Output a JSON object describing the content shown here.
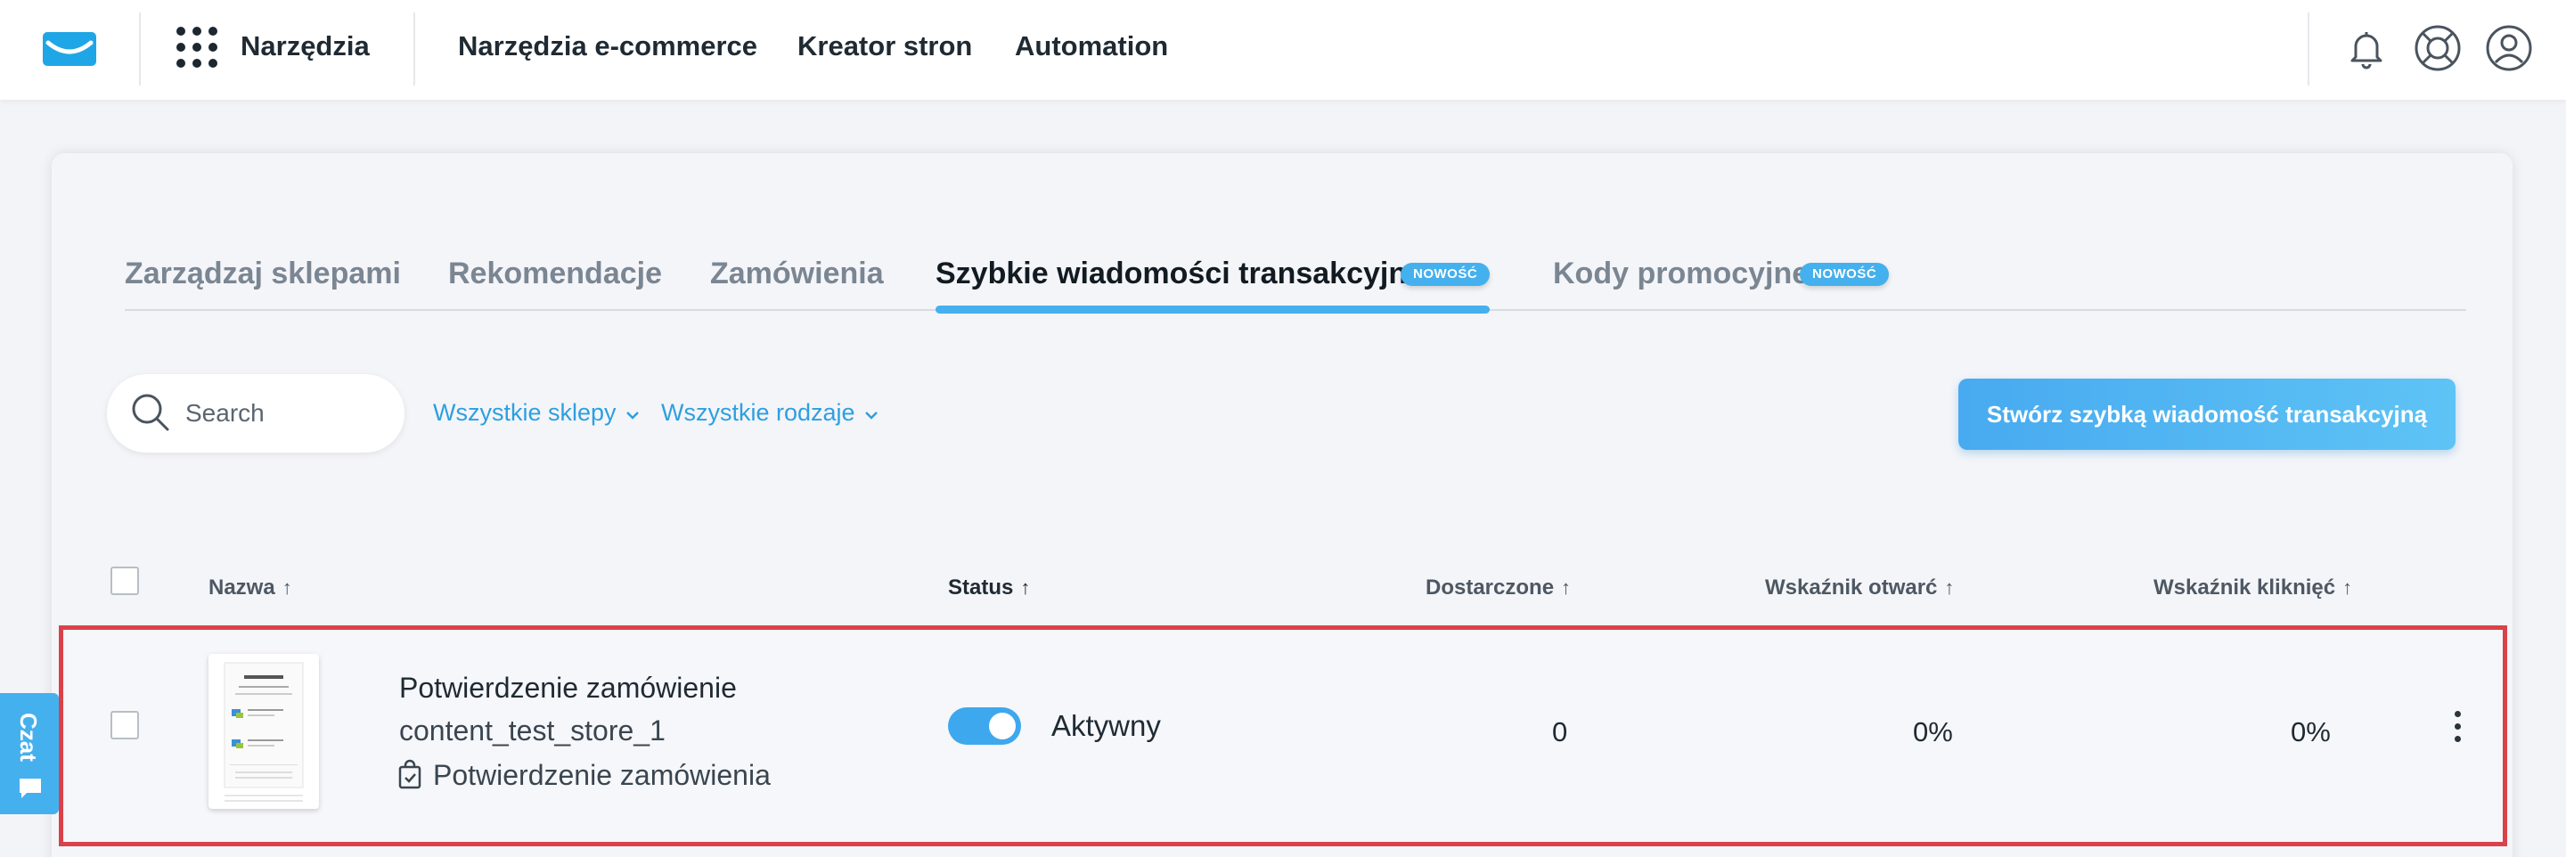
{
  "header": {
    "logo_icon": "envelope-logo-icon",
    "tools_label": "Narzędzia",
    "nav": [
      "Narzędzia e-commerce",
      "Kreator stron",
      "Automation"
    ],
    "icons": [
      "bell-icon",
      "lifebuoy-icon",
      "user-avatar-icon"
    ]
  },
  "tabs": [
    {
      "label": "Zarządzaj sklepami",
      "active": false
    },
    {
      "label": "Rekomendacje",
      "active": false
    },
    {
      "label": "Zamówienia",
      "active": false
    },
    {
      "label": "Szybkie wiadomości transakcyjne",
      "active": true,
      "badge": "NOWOŚĆ"
    },
    {
      "label": "Kody promocyjne",
      "active": false,
      "badge": "NOWOŚĆ"
    }
  ],
  "toolbar": {
    "search_placeholder": "Search",
    "filter_stores": "Wszystkie sklepy",
    "filter_types": "Wszystkie rodzaje",
    "create_button": "Stwórz szybką wiadomość transakcyjną"
  },
  "table": {
    "columns": [
      "Nazwa",
      "Status",
      "Dostarczone",
      "Wskaźnik otwarć",
      "Wskaźnik kliknięć"
    ],
    "sort_arrow": "↑",
    "rows": [
      {
        "name": "Potwierdzenie zamówienie",
        "store": "content_test_store_1",
        "type": "Potwierdzenie zamówienia",
        "status_on": true,
        "status": "Aktywny",
        "delivered": "0",
        "open_rate": "0%",
        "click_rate": "0%"
      }
    ]
  },
  "chat": {
    "label": "Czat"
  },
  "colors": {
    "accent": "#45b0ee",
    "highlight_border": "#d9424a"
  }
}
